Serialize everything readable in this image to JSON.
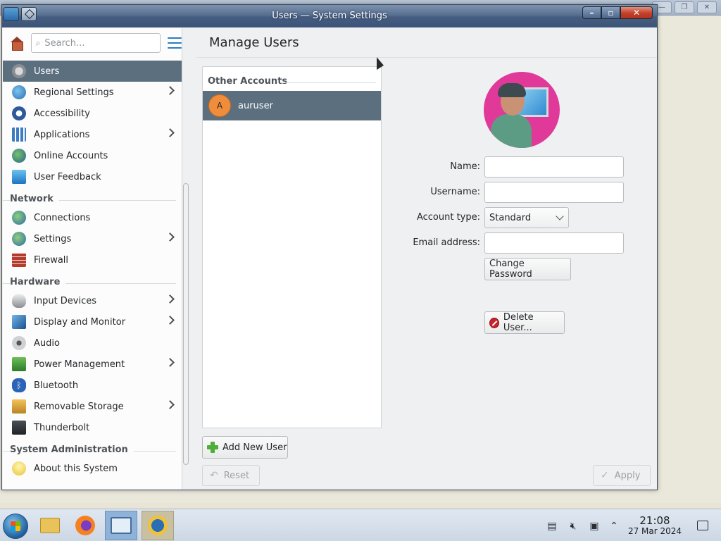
{
  "window": {
    "title": "Users — System Settings"
  },
  "sidebar": {
    "search_placeholder": "Search...",
    "items": [
      {
        "label": "Users",
        "icon": "users-icon",
        "active": true,
        "chevron": false
      },
      {
        "label": "Regional Settings",
        "icon": "globe-icon",
        "chevron": true
      },
      {
        "label": "Accessibility",
        "icon": "accessibility-icon",
        "chevron": false
      },
      {
        "label": "Applications",
        "icon": "applications-icon",
        "chevron": true
      },
      {
        "label": "Online Accounts",
        "icon": "online-accounts-icon",
        "chevron": false
      },
      {
        "label": "User Feedback",
        "icon": "feedback-icon",
        "chevron": false
      }
    ],
    "sections": [
      {
        "header": "Network",
        "items": [
          {
            "label": "Connections",
            "icon": "network-globe-icon",
            "chevron": false
          },
          {
            "label": "Settings",
            "icon": "network-settings-icon",
            "chevron": true
          },
          {
            "label": "Firewall",
            "icon": "firewall-icon",
            "chevron": false
          }
        ]
      },
      {
        "header": "Hardware",
        "items": [
          {
            "label": "Input Devices",
            "icon": "mouse-icon",
            "chevron": true
          },
          {
            "label": "Display and Monitor",
            "icon": "monitor-icon",
            "chevron": true
          },
          {
            "label": "Audio",
            "icon": "speaker-icon",
            "chevron": false
          },
          {
            "label": "Power Management",
            "icon": "power-icon",
            "chevron": true
          },
          {
            "label": "Bluetooth",
            "icon": "bluetooth-icon",
            "chevron": false
          },
          {
            "label": "Removable Storage",
            "icon": "storage-icon",
            "chevron": true
          },
          {
            "label": "Thunderbolt",
            "icon": "thunderbolt-icon",
            "chevron": false
          }
        ]
      },
      {
        "header": "System Administration",
        "items": [
          {
            "label": "About this System",
            "icon": "lightbulb-icon",
            "chevron": false
          }
        ]
      }
    ]
  },
  "main": {
    "title": "Manage Users",
    "accounts_header": "Other Accounts",
    "accounts": [
      {
        "initial": "A",
        "username": "auruser"
      }
    ],
    "add_user_label": "Add New User",
    "reset_label": "Reset",
    "apply_label": "Apply",
    "form": {
      "name_label": "Name:",
      "name_value": "",
      "username_label": "Username:",
      "username_value": "",
      "account_type_label": "Account type:",
      "account_type_value": "Standard",
      "email_label": "Email address:",
      "email_value": "",
      "change_password_label": "Change Password",
      "delete_user_label": "Delete User..."
    }
  },
  "taskbar": {
    "time": "21:08",
    "date": "27 Mar 2024"
  },
  "colors": {
    "active_item": "#5b6f7f",
    "accent": "#2a7cc4",
    "avatar_bg": "#e0399a",
    "small_avatar": "#f08d3a"
  }
}
